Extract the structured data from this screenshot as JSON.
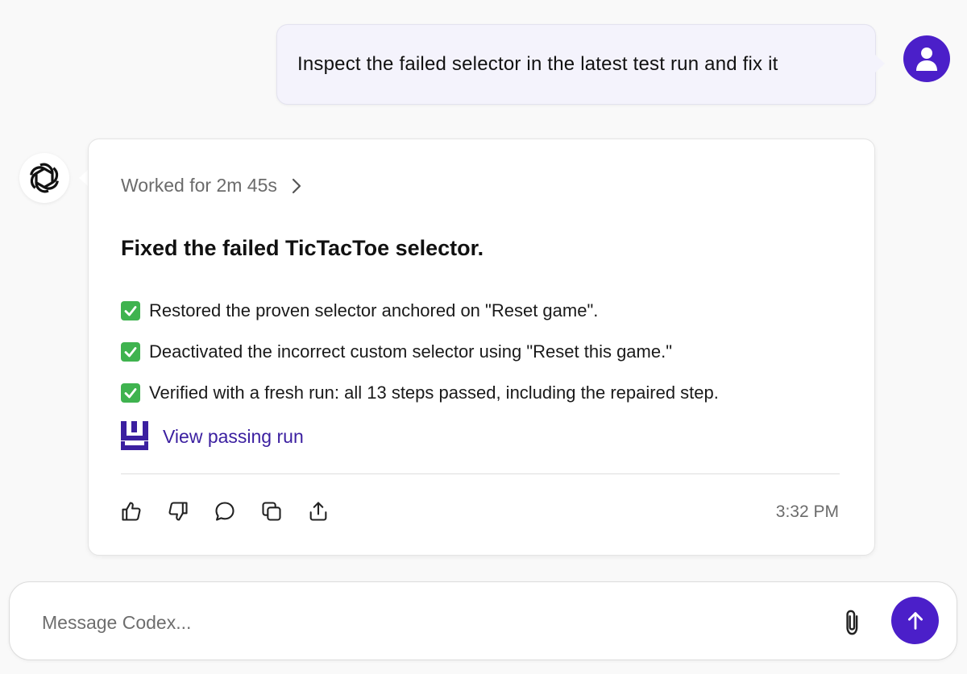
{
  "user_message": {
    "text": "Inspect the failed selector in the latest test run and fix it",
    "avatar_icon": "user-icon"
  },
  "assistant_message": {
    "avatar_icon": "openai-logo-icon",
    "worked_for": "Worked for 2m 45s",
    "title": "Fixed the failed TicTacToe selector.",
    "checklist": [
      {
        "icon": "check-icon",
        "text": "Restored the proven selector anchored on \"Reset game\"."
      },
      {
        "icon": "check-icon",
        "text": "Deactivated the incorrect custom selector using \"Reset this game.\""
      },
      {
        "icon": "check-icon",
        "text": "Verified with a fresh run: all 13 steps passed, including the repaired step."
      }
    ],
    "run_link": {
      "icon": "pixel-logo-icon",
      "label": "View passing run"
    },
    "actions": [
      "thumbs-up-icon",
      "thumbs-down-icon",
      "comment-icon",
      "copy-icon",
      "share-icon"
    ],
    "timestamp": "3:32 PM"
  },
  "composer": {
    "placeholder": "Message Codex...",
    "attach_icon": "paperclip-icon",
    "send_icon": "arrow-up-icon"
  },
  "colors": {
    "accent": "#4b1fc9",
    "link": "#3b1fa0",
    "check": "#3fb34f",
    "user_bubble": "#f4f3fc",
    "background": "#f9f9f9"
  }
}
